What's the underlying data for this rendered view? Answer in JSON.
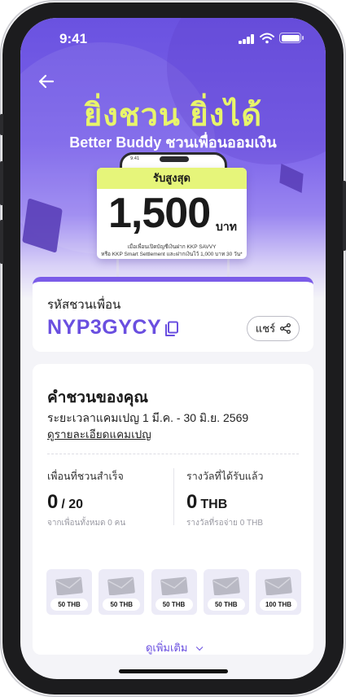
{
  "status": {
    "time": "9:41"
  },
  "hero": {
    "headline": "ยิ่งชวน ยิ่งได้",
    "subhead": "Better Buddy ชวนเพื่อนออมเงิน",
    "mini_phone_time": "9:41",
    "tag": "รับสูงสุด",
    "amount": "1,500",
    "unit": "บาท",
    "note_line1": "เมื่อเพื่อนเปิดบัญชีเงินฝาก KKP SAVVY",
    "note_line2": "หรือ KKP Smart Settlement และฝากเงินไว้ 1,000 บาท 30 วัน*"
  },
  "referral": {
    "label": "รหัสชวนเพื่อน",
    "code": "NYP3GYCY",
    "share_label": "แชร์"
  },
  "invites": {
    "title": "คำชวนของคุณ",
    "period": "ระยะเวลาแคมเปญ 1 มี.ค. - 30 มิ.ย. 2569",
    "details_link": "ดูรายละเอียดแคมเปญ",
    "friends_label": "เพื่อนที่ชวนสำเร็จ",
    "friends_count": "0",
    "friends_total": "/ 20",
    "friends_sub": "จากเพื่อนทั้งหมด 0 คน",
    "reward_label": "รางวัลที่ได้รับแล้ว",
    "reward_amount": "0",
    "reward_unit": "THB",
    "reward_sub": "รางวัลที่รอจ่าย 0 THB",
    "reward_items": [
      "50 THB",
      "50 THB",
      "50 THB",
      "50 THB",
      "100 THB"
    ],
    "more_label": "ดูเพิ่มเติม"
  },
  "colors": {
    "accent": "#6a4fe0",
    "highlight": "#e6f57a"
  }
}
